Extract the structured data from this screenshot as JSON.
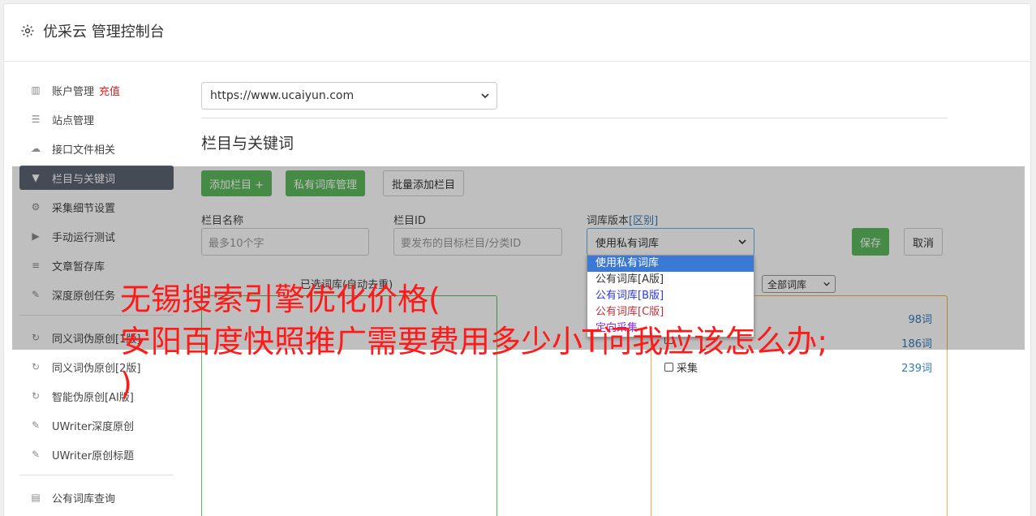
{
  "header": {
    "title": "优采云 管理控制台",
    "icon": "gear-icon"
  },
  "sidebar": {
    "items": [
      {
        "label": "账户管理",
        "extra": "充值",
        "icon": "bar-chart-icon"
      },
      {
        "label": "站点管理",
        "icon": "server-icon"
      },
      {
        "label": "接口文件相关",
        "icon": "cloud-upload-icon"
      },
      {
        "label": "栏目与关键词",
        "icon": "filter-icon",
        "active": true
      },
      {
        "label": "采集细节设置",
        "icon": "gears-icon"
      },
      {
        "label": "手动运行测试",
        "icon": "play-circle-icon"
      },
      {
        "label": "文章暂存库",
        "icon": "database-icon"
      },
      {
        "label": "深度原创任务",
        "icon": "edit-icon"
      },
      {
        "label": "同义词伪原创[1版]",
        "icon": "refresh-icon"
      },
      {
        "label": "同义词伪原创[2版]",
        "icon": "refresh-icon"
      },
      {
        "label": "智能伪原创[AI版]",
        "icon": "refresh-icon"
      },
      {
        "label": "UWriter深度原创",
        "icon": "edit-icon"
      },
      {
        "label": "UWriter原创标题",
        "icon": "edit-icon"
      },
      {
        "label": "公有词库查询",
        "icon": "book-icon"
      }
    ]
  },
  "main": {
    "site_select": "https://www.ucaiyun.com",
    "section_title": "栏目与关键词",
    "buttons": {
      "add_column": "添加栏目 +",
      "private_lib": "私有词库管理",
      "batch_add": "批量添加栏目",
      "save": "保存",
      "cancel": "取消"
    },
    "form": {
      "column_name_label": "栏目名称",
      "column_name_placeholder": "最多10个字",
      "column_id_label": "栏目ID",
      "column_id_placeholder": "要发布的目标栏目/分类ID",
      "lib_version_label": "词库版本",
      "lib_version_link": "[区别]",
      "lib_version_value": "使用私有词库",
      "lib_version_options": [
        "使用私有词库",
        "公有词库[A版]",
        "公有词库[B版]",
        "公有词库[C版]",
        "定向采集"
      ]
    },
    "left_panel_label": "已选词库(自动去重)",
    "filter_select": "全部词库",
    "right_panel_rows": [
      {
        "label": "",
        "count": "98词"
      },
      {
        "label": "",
        "count": "186词"
      },
      {
        "label": "采集",
        "count": "239词"
      }
    ]
  },
  "watermark": {
    "line1": "无锡搜索引擎优化价格(",
    "line2": "安阳百度快照推广需要费用多少小T问我应该怎么办;",
    "line3": ")"
  },
  "colors": {
    "green": "#5cb85c",
    "active_nav": "#5d6470",
    "red_text": "#ff1a1a",
    "link": "#337ab7"
  }
}
